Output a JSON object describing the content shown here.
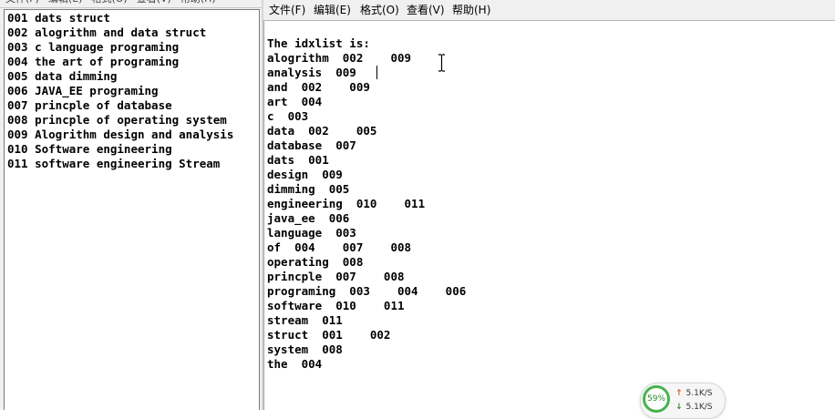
{
  "left_window": {
    "menu": [
      "文件(F)",
      "编辑(E)",
      "格式(O)",
      "查看(V)",
      "帮助(H)"
    ],
    "lines": [
      "001 dats struct",
      "002 alogrithm and data struct",
      "003 c language programing",
      "004 the art of programing",
      "005 data dimming",
      "006 JAVA_EE programing",
      "007 princple of database",
      "008 princple of operating system",
      "009 Alogrithm design and analysis",
      "010 Software engineering",
      "011 software engineering Stream"
    ]
  },
  "right_window": {
    "menu": [
      "文件(F)",
      "编辑(E)",
      "格式(O)",
      "查看(V)",
      "帮助(H)"
    ],
    "lines": [
      "",
      "The idxlist is:",
      "alogrithm  002    009",
      "analysis  009",
      "and  002    009",
      "art  004",
      "c  003",
      "data  002    005",
      "database  007",
      "dats  001",
      "design  009",
      "dimming  005",
      "engineering  010    011",
      "java_ee  006",
      "language  003",
      "of  004    007    008",
      "operating  008",
      "princple  007    008",
      "programing  003    004    006",
      "software  010    011",
      "stream  011",
      "struct  001    002",
      "system  008",
      "the  004"
    ]
  },
  "net_widget": {
    "percent": "59%",
    "upload": "5.1K/S",
    "download": "5.1K/S",
    "colors": {
      "gauge": "#49b24d",
      "up_arrow": "#e05a1a",
      "down_arrow": "#2a8a2a"
    }
  }
}
